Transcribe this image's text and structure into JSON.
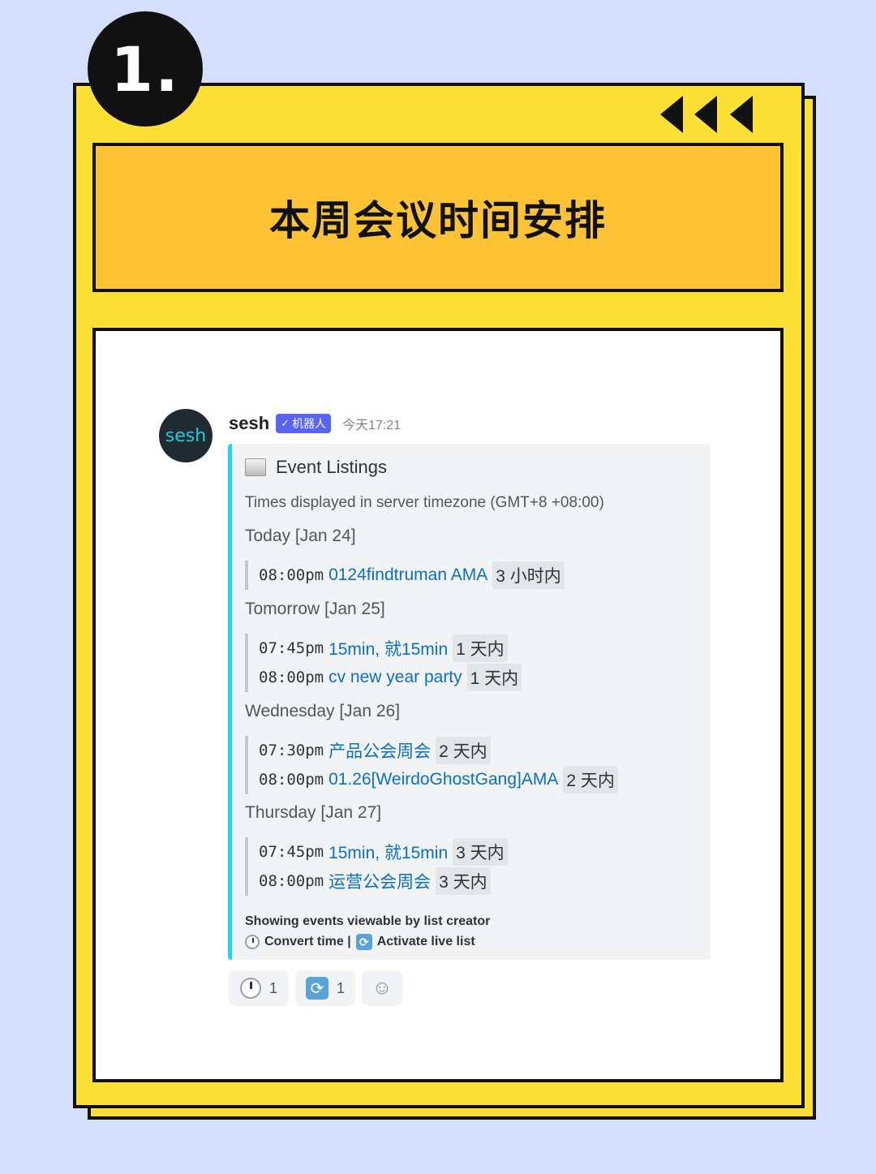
{
  "badge": {
    "number": "1."
  },
  "header": {
    "title": "本周会议时间安排"
  },
  "message": {
    "avatar_text": "sesh",
    "username": "sesh",
    "bot_tag": "机器人",
    "bot_check": "✓",
    "timestamp": "今天17:21"
  },
  "embed": {
    "title": "Event Listings",
    "timezone_note": "Times displayed in server timezone (GMT+8 +08:00)",
    "days": [
      {
        "label": "Today [Jan 24]",
        "events": [
          {
            "time": "08:00pm",
            "name": "0124findtruman AMA",
            "relative": "3 小时内"
          }
        ]
      },
      {
        "label": "Tomorrow [Jan 25]",
        "events": [
          {
            "time": "07:45pm",
            "name": "15min, 就15min",
            "relative": "1 天内"
          },
          {
            "time": "08:00pm",
            "name": "cv new year party",
            "relative": "1 天内"
          }
        ]
      },
      {
        "label": "Wednesday [Jan 26]",
        "events": [
          {
            "time": "07:30pm",
            "name": "产品公会周会",
            "relative": "2 天内"
          },
          {
            "time": "08:00pm",
            "name": "01.26[WeirdoGhostGang]AMA",
            "relative": "2 天内"
          }
        ]
      },
      {
        "label": "Thursday [Jan 27]",
        "events": [
          {
            "time": "07:45pm",
            "name": "15min, 就15min",
            "relative": "3 天内"
          },
          {
            "time": "08:00pm",
            "name": "运营公会周会",
            "relative": "3 天内"
          }
        ]
      }
    ],
    "footer_line1": "Showing events viewable by list creator",
    "footer_convert": "Convert time |",
    "footer_activate": "Activate live list"
  },
  "reactions": [
    {
      "icon": "clock-icon",
      "count": "1"
    },
    {
      "icon": "repeat-icon",
      "count": "1"
    }
  ],
  "colors": {
    "background": "#d3dffd",
    "card": "#fde036",
    "title_box": "#fec334",
    "embed_accent": "#16dcf0",
    "link": "#0b6fc4",
    "bot_tag": "#5865f2"
  }
}
